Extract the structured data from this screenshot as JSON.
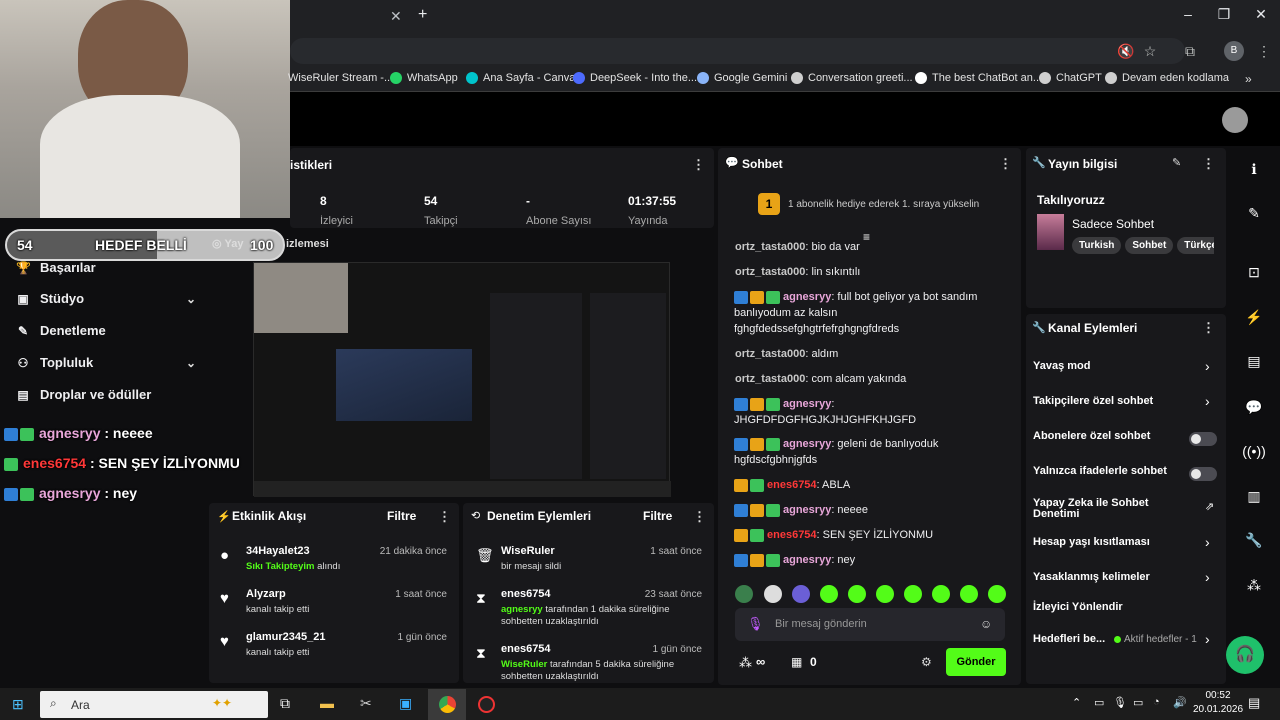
{
  "browser": {
    "close_tab": "✕",
    "new_tab": "+",
    "bookmarks": [
      {
        "label": "WiseRuler Stream -...",
        "color": "#53fc18"
      },
      {
        "label": "WhatsApp",
        "color": "#25d366"
      },
      {
        "label": "Ana Sayfa - Canva",
        "color": "#00c4cc"
      },
      {
        "label": "DeepSeek - Into the...",
        "color": "#4d6bfe"
      },
      {
        "label": "Google Gemini",
        "color": "#8ab4f8"
      },
      {
        "label": "Conversation greeti...",
        "color": "#cfcfcf"
      },
      {
        "label": "The best ChatBot an...",
        "color": "#ffffff"
      },
      {
        "label": "ChatGPT",
        "color": "#cfcfcf"
      },
      {
        "label": "Devam eden kodlama",
        "color": "#cfcfcf"
      }
    ],
    "profile_letter": "B"
  },
  "stats": {
    "title": "istikleri",
    "items": [
      {
        "value": "8",
        "label": "İzleyici"
      },
      {
        "value": "54",
        "label": "Takipçi"
      },
      {
        "value": "-",
        "label": "Abone Sayısı"
      },
      {
        "value": "01:37:55",
        "label": "Yayında"
      }
    ]
  },
  "overlay": {
    "goal_left": "54",
    "goal_text": "HEDEF BELLİ",
    "goal_right": "100",
    "preview_label": "Yayın Önizlemesi",
    "preview_visible": "Yay",
    "preview_tail": "izlemesi",
    "chat": [
      {
        "user": "agnesryy",
        "msg": " : neeee",
        "color": "#e8a6d9",
        "badges": [
          "blue",
          "green"
        ]
      },
      {
        "user": "enes6754",
        "msg": " : SEN ŞEY İZLİYONMU",
        "color": "#ff3838",
        "badges": [
          "green"
        ]
      },
      {
        "user": "agnesryy",
        "msg": " : ney",
        "color": "#e8a6d9",
        "badges": [
          "blue",
          "green"
        ]
      }
    ]
  },
  "sidebar": {
    "items": [
      {
        "label": "Başarılar",
        "icon": "trophy-icon",
        "glyph": "🏆",
        "chev": ""
      },
      {
        "label": "Stüdyo",
        "icon": "studio-icon",
        "glyph": "▣",
        "chev": "⌄"
      },
      {
        "label": "Denetleme",
        "icon": "wrench-icon",
        "glyph": "✎",
        "chev": ""
      },
      {
        "label": "Topluluk",
        "icon": "community-icon",
        "glyph": "⚇",
        "chev": "⌄"
      },
      {
        "label": "Droplar ve ödüller",
        "icon": "gift-icon",
        "glyph": "▤",
        "chev": ""
      }
    ]
  },
  "activity": {
    "title": "Etkinlik Akışı",
    "filter": "Filtre",
    "items": [
      {
        "name": "34Hayalet23",
        "time": "21 dakika önce",
        "sub1": "Sıkı Takipteyim",
        "sub2": " alındı",
        "icon": "reward-icon",
        "glyph": "●"
      },
      {
        "name": "Alyzarp",
        "time": "1 saat önce",
        "sub1": "",
        "sub2": "kanalı takip etti",
        "icon": "heart-icon",
        "glyph": "♥"
      },
      {
        "name": "glamur2345_21",
        "time": "1 gün önce",
        "sub1": "",
        "sub2": "kanalı takip etti",
        "icon": "heart-icon",
        "glyph": "♥"
      }
    ]
  },
  "modactions": {
    "title": "Denetim Eylemleri",
    "filter": "Filtre",
    "items": [
      {
        "name": "WiseRuler",
        "time": "1 saat önce",
        "actor": "",
        "text": "bir mesajı sildi",
        "icon": "trash-icon",
        "glyph": "🗑"
      },
      {
        "name": "enes6754",
        "time": "23 saat önce",
        "actor": "agnesryy",
        "text": " tarafından 1 dakika süreliğine sohbetten uzaklaştırıldı",
        "icon": "hourglass-icon",
        "glyph": "⧗"
      },
      {
        "name": "enes6754",
        "time": "1 gün önce",
        "actor": "WiseRuler",
        "text": " tarafından 5 dakika süreliğine sohbetten uzaklaştırıldı",
        "icon": "hourglass-icon",
        "glyph": "⧗"
      }
    ]
  },
  "chat": {
    "title": "Sohbet",
    "gift_rank": "1",
    "gift_text": "1 abonelik hediye ederek 1. sıraya yükselin",
    "messages": [
      {
        "user": "ortz_tasta000",
        "text": " bio da var",
        "ucls": "un-g",
        "badges": []
      },
      {
        "user": "ortz_tasta000",
        "text": " lin sıkıntılı",
        "ucls": "un-g",
        "badges": []
      },
      {
        "user": "agnesryy",
        "text": " full bot geliyor ya bot sandım banlıyodum az kalsın fghgfdedssefghgtrfefrghgngfdreds",
        "ucls": "un-p",
        "badges": [
          "blue",
          "gold",
          "green"
        ]
      },
      {
        "user": "ortz_tasta000",
        "text": " aldım",
        "ucls": "un-g",
        "badges": []
      },
      {
        "user": "ortz_tasta000",
        "text": " com alcam yakında",
        "ucls": "un-g",
        "badges": []
      },
      {
        "user": "agnesryy",
        "text": " JHGFDFDGFHGJKJHJGHFKHJGFD",
        "ucls": "un-p",
        "badges": [
          "blue",
          "gold",
          "green"
        ]
      },
      {
        "user": "agnesryy",
        "text": " geleni de banlıyoduk hgfdscfgbhnjgfds",
        "ucls": "un-p",
        "badges": [
          "blue",
          "gold",
          "green"
        ]
      },
      {
        "user": "enes6754",
        "text": " ABLA",
        "ucls": "un-r",
        "badges": [
          "gold",
          "green"
        ]
      },
      {
        "user": "agnesryy",
        "text": " neeee",
        "ucls": "un-p",
        "badges": [
          "blue",
          "gold",
          "green"
        ]
      },
      {
        "user": "enes6754",
        "text": " SEN ŞEY İZLİYONMU",
        "ucls": "un-r",
        "badges": [
          "gold",
          "green"
        ]
      },
      {
        "user": "agnesryy",
        "text": " ney",
        "ucls": "un-p",
        "badges": [
          "blue",
          "gold",
          "green"
        ]
      }
    ],
    "placeholder": "Bir mesaj gönderin",
    "points": "∞",
    "gift_count": "0",
    "send": "Gönder"
  },
  "streaminfo": {
    "title": "Yayın bilgisi",
    "stream_title": "Takılıyoruzz",
    "category": "Sadece Sohbet",
    "tags": [
      "Turkish",
      "Sohbet",
      "Türkçe"
    ]
  },
  "channel_actions": {
    "title": "Kanal Eylemleri",
    "items": [
      {
        "label": "Yavaş mod",
        "ctl": "chevron"
      },
      {
        "label": "Takipçilere özel sohbet",
        "ctl": "chevron"
      },
      {
        "label": "Abonelere özel sohbet",
        "ctl": "toggle"
      },
      {
        "label": "Yalnızca ifadelerle sohbet",
        "ctl": "toggle"
      },
      {
        "label": "Yapay Zeka ile Sohbet Denetimi",
        "ctl": "external"
      },
      {
        "label": "Hesap yaşı kısıtlaması",
        "ctl": "chevron"
      },
      {
        "label": "Yasaklanmış kelimeler",
        "ctl": "chevron"
      },
      {
        "label": "İzleyici Yönlendir",
        "ctl": "none"
      }
    ],
    "goals_label": "Hedefleri be...",
    "goals_status": "Aktif hedefler - 1"
  },
  "taskbar": {
    "search": "Ara",
    "time": "00:52",
    "date": "20.01.2026"
  },
  "colors": {
    "accent": "#53fc18",
    "panel": "#18181b",
    "bg": "#0e0e10"
  }
}
